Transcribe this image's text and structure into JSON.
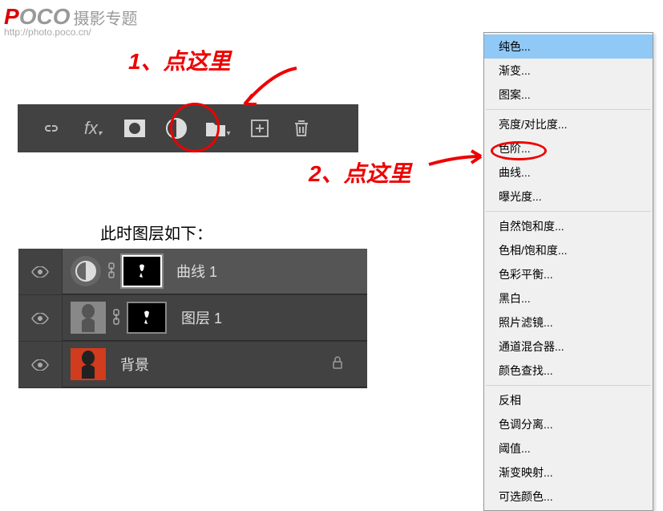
{
  "watermark": {
    "logo_red": "P",
    "logo_gray": "OCO",
    "logo_cn": "摄影专题",
    "url": "http://photo.poco.cn/"
  },
  "toolbar": {
    "icons": [
      "link-icon",
      "fx-icon",
      "mask-icon",
      "adjustment-icon",
      "folder-icon",
      "new-layer-icon",
      "delete-icon"
    ]
  },
  "caption": "此时图层如下：",
  "layers": [
    {
      "name": "曲线 1",
      "type": "curves",
      "has_mask": true,
      "selected": true
    },
    {
      "name": "图层 1",
      "type": "layer",
      "has_mask": true,
      "thumb": "gray"
    },
    {
      "name": "背景",
      "type": "background",
      "thumb": "red",
      "locked": true
    }
  ],
  "menu": {
    "groups": [
      [
        "纯色...",
        "渐变...",
        "图案..."
      ],
      [
        "亮度/对比度...",
        "色阶...",
        "曲线...",
        "曝光度..."
      ],
      [
        "自然饱和度...",
        "色相/饱和度...",
        "色彩平衡...",
        "黑白...",
        "照片滤镜...",
        "通道混合器...",
        "颜色查找..."
      ],
      [
        "反相",
        "色调分离...",
        "阈值...",
        "渐变映射...",
        "可选颜色..."
      ]
    ],
    "highlighted": "纯色..."
  },
  "annotations": {
    "text1": "1、点这里",
    "text2": "2、点这里"
  }
}
